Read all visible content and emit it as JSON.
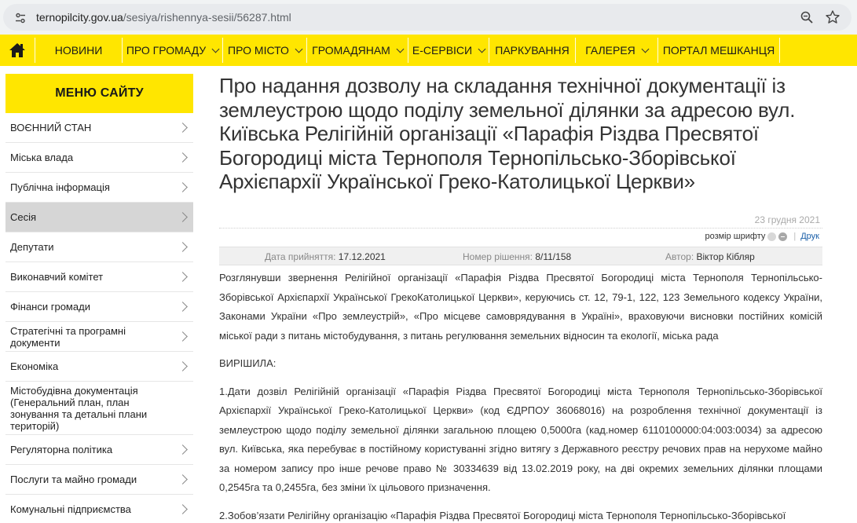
{
  "browser": {
    "url_host": "ternopilcity.gov.ua",
    "url_path": "/sesiya/rishennya-sesii/56287.html"
  },
  "nav": {
    "items": [
      {
        "label": "Новини"
      },
      {
        "label": "Про громаду"
      },
      {
        "label": "Про місто"
      },
      {
        "label": "Громадянам"
      },
      {
        "label": "Е-сервіси"
      },
      {
        "label": "Паркування"
      },
      {
        "label": "Галерея"
      },
      {
        "label": "Портал мешканця"
      }
    ]
  },
  "sidebar": {
    "title": "МЕНЮ САЙТУ",
    "items": [
      {
        "label": "ВОЄННИЙ СТАН"
      },
      {
        "label": "Міська влада"
      },
      {
        "label": "Публічна інформація"
      },
      {
        "label": "Сесія"
      },
      {
        "label": "Депутати"
      },
      {
        "label": "Виконавчий комітет"
      },
      {
        "label": "Фінанси громади"
      },
      {
        "label": "Стратегічні та програмні документи"
      },
      {
        "label": "Економіка"
      },
      {
        "label": "Містобудівна документація (Генеральний план, план зонування та детальні плани територій)"
      },
      {
        "label": "Регуляторна політика"
      },
      {
        "label": "Послуги та майно громади"
      },
      {
        "label": "Комунальні підприємства"
      }
    ]
  },
  "document": {
    "title": "Про надання дозволу на складання технічної документації із землеустрою щодо поділу земельної ділянки за адресою вул. Київська Релігійній організації «Парафія Різдва Пресвятої Богородиці міста Тернополя Тернопільсько-Зборівської Архієпархії Української Греко-Католицької Церкви»",
    "date": "23 грудня 2021",
    "font_size_label": "розмір шрифту",
    "print_label": "Друк",
    "adopted_label": "Дата прийняття:",
    "adopted_value": "17.12.2021",
    "number_label": "Номер рішення:",
    "number_value": "8/11/158",
    "author_label": "Автор:",
    "author_value": "Віктор Кібляр",
    "paragraphs": [
      "Розглянувши звернення Релігійної організації «Парафія Різдва Пресвятої Богородиці міста Тернополя Тернопільсько-Зборівської Архієпархії Української ГрекоКатолицької Церкви», керуючись ст. 12, 79-1, 122, 123 Земельного кодексу України, Законами України «Про землеустрій», «Про місцеве самоврядування в Україні», враховуючи висновки постійних комісій міської ради з питань містобудування, з питань регулювання земельних відносин та екології, міська рада",
      "ВИРІШИЛА:",
      "1.Дати дозвіл Релігійній організації «Парафія Різдва Пресвятої Богородиці міста Тернополя Тернопільсько-Зборівської Архієпархії Української Греко-Католицької Церкви» (код ЄДРПОУ 36068016) на розроблення технічної документації із землеустрою щодо поділу земельної ділянки загальною площею 0,5000га (кад.номер 6110100000:04:003:0034) за адресою вул. Київська, яка перебуває в постійному користуванні згідно витягу з Державного реєстру речових прав на нерухоме майно за номером запису про інше речове право № 30334639 від 13.02.2019 року, на дві окремих земельних ділянки площами 0,2545га та 0,2455га, без зміни їх цільового призначення.",
      "2.Зобов’язати Релігійну організацію «Парафія Різдва Пресвятої Богородиці міста Тернополя Тернопільсько-Зборівської"
    ]
  }
}
